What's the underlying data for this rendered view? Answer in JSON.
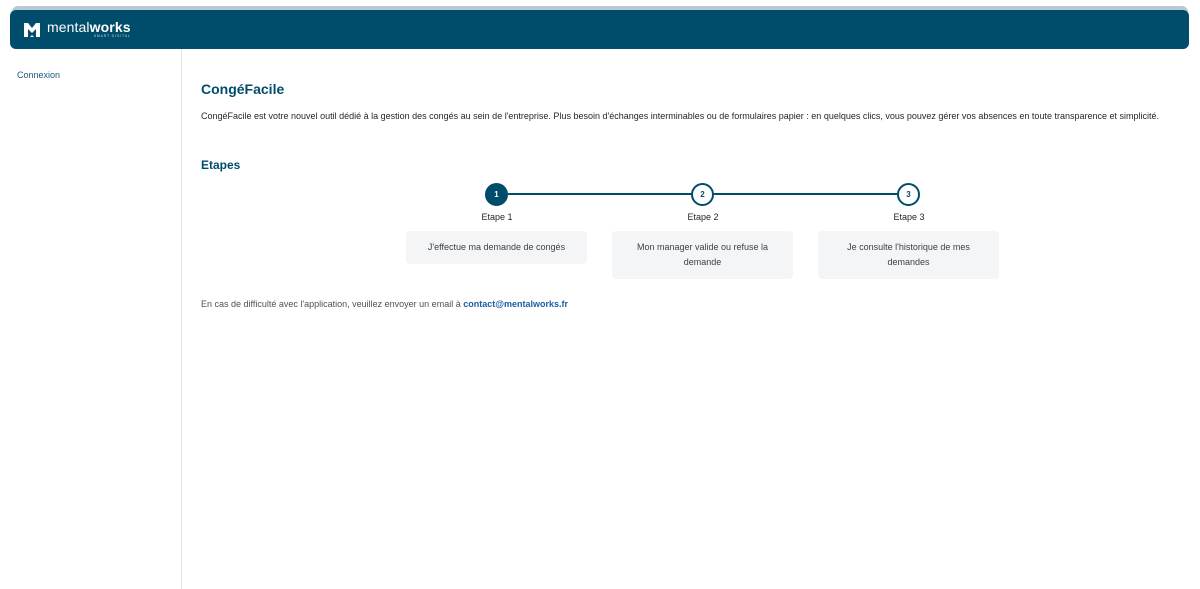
{
  "brand": {
    "name_light": "mental",
    "name_bold": "works",
    "tagline": "SMART DIGITAL",
    "icon": "mentalworks-logo-icon",
    "color": "#004d6b"
  },
  "sidebar": {
    "items": [
      {
        "label": "Connexion"
      }
    ]
  },
  "main": {
    "title": "CongéFacile",
    "intro": "CongéFacile est votre nouvel outil dédié à la gestion des congés au sein de l'entreprise. Plus besoin d'échanges interminables ou de formulaires papier : en quelques clics, vous pouvez gérer vos absences en toute transparence et simplicité.",
    "steps_title": "Etapes",
    "steps": [
      {
        "number": "1",
        "label": "Etape 1",
        "description": "J'effectue ma demande de congés",
        "active": true
      },
      {
        "number": "2",
        "label": "Etape 2",
        "description": "Mon manager valide ou refuse la demande",
        "active": false
      },
      {
        "number": "3",
        "label": "Etape 3",
        "description": "Je consulte l'historique de mes demandes",
        "active": false
      }
    ],
    "contact": {
      "text": "En cas de difficulté avec l'application, veuillez envoyer un email à",
      "email": "contact@mentalworks.fr"
    }
  }
}
